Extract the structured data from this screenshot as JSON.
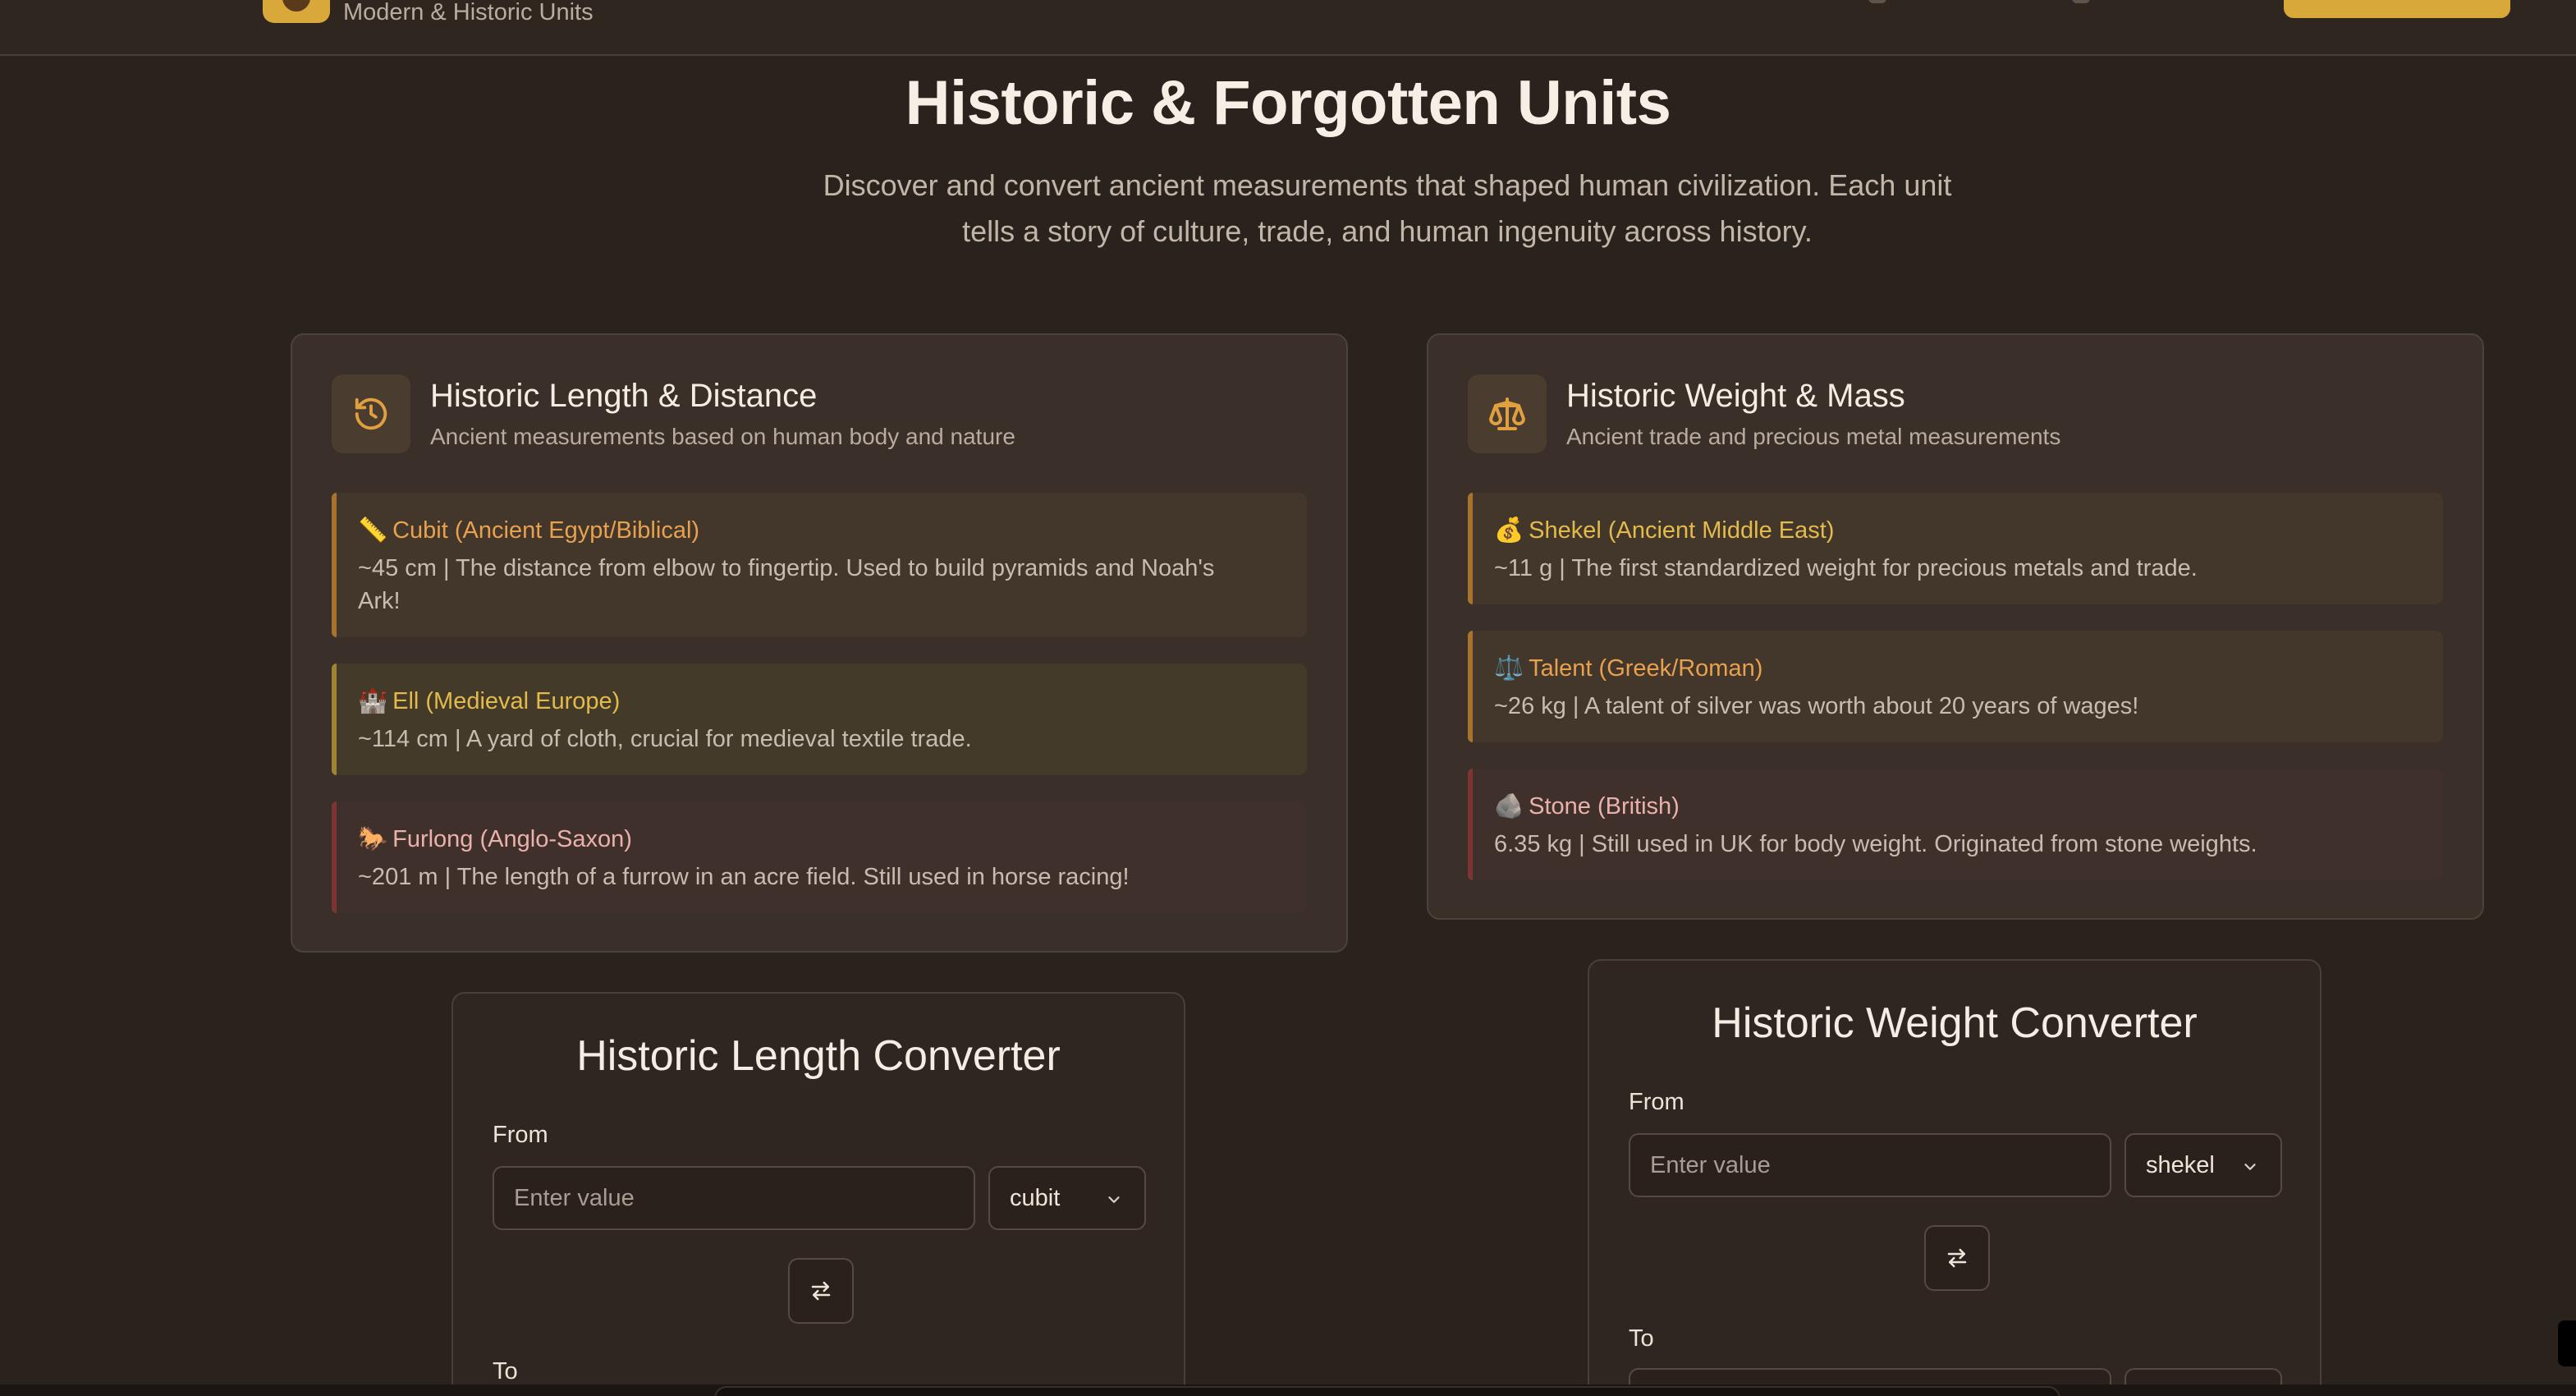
{
  "header": {
    "brand_subtitle": "Modern & Historic Units",
    "accent_color": "#d9a83a"
  },
  "hero": {
    "title": "Historic & Forgotten Units",
    "subtitle_line1": "Discover and convert ancient measurements that shaped human civilization. Each unit",
    "subtitle_line2": "tells a story of culture, trade, and human ingenuity across history."
  },
  "length_card": {
    "icon": "history-icon",
    "title": "Historic Length & Distance",
    "desc": "Ancient measurements based on human body and nature",
    "units": [
      {
        "emoji": "📏",
        "name": "Cubit (Ancient Egypt/Biblical)",
        "line1": "~45 cm | The distance from elbow to fingertip. Used to build pyramids and Noah's",
        "line2": "Ark!"
      },
      {
        "emoji": "🏰",
        "name": "Ell (Medieval Europe)",
        "line1": "~114 cm | A yard of cloth, crucial for medieval textile trade."
      },
      {
        "emoji": "🐎",
        "name": "Furlong (Anglo-Saxon)",
        "line1": "~201 m | The length of a furrow in an acre field. Still used in horse racing!"
      }
    ]
  },
  "weight_card": {
    "icon": "scale-icon",
    "title": "Historic Weight & Mass",
    "desc": "Ancient trade and precious metal measurements",
    "units": [
      {
        "emoji": "💰",
        "name": "Shekel (Ancient Middle East)",
        "line1": "~11 g | The first standardized weight for precious metals and trade."
      },
      {
        "emoji": "⚖️",
        "name": "Talent (Greek/Roman)",
        "line1": "~26 kg | A talent of silver was worth about 20 years of wages!"
      },
      {
        "emoji": "🪨",
        "name": "Stone (British)",
        "line1": "6.35 kg | Still used in UK for body weight. Originated from stone weights."
      }
    ]
  },
  "length_converter": {
    "title": "Historic Length Converter",
    "from_label": "From",
    "placeholder": "Enter value",
    "unit": "cubit",
    "to_label": "To"
  },
  "weight_converter": {
    "title": "Historic Weight Converter",
    "from_label": "From",
    "placeholder": "Enter value",
    "unit": "shekel",
    "to_label": "To"
  }
}
